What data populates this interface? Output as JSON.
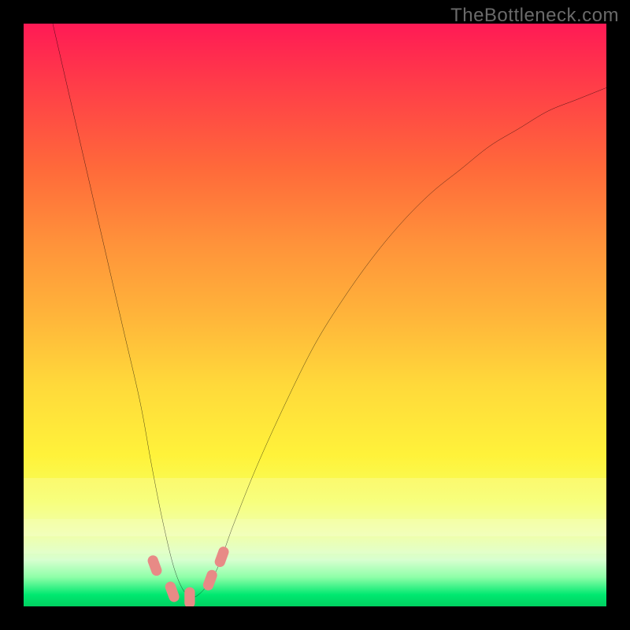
{
  "watermark": {
    "text": "TheBottleneck.com"
  },
  "colors": {
    "frame": "#000000",
    "curve": "#000000",
    "marker": "#e88a86",
    "grad_top": "#ff1a55",
    "grad_bottom": "#00d060"
  },
  "chart_data": {
    "type": "line",
    "title": "",
    "xlabel": "",
    "ylabel": "",
    "xlim": [
      0,
      100
    ],
    "ylim": [
      0,
      100
    ],
    "grid": false,
    "legend": false,
    "series": [
      {
        "name": "bottleneck-curve",
        "x": [
          5,
          8,
          11,
          14,
          17,
          20,
          22,
          24,
          26,
          28,
          30,
          33,
          36,
          40,
          45,
          50,
          55,
          60,
          65,
          70,
          75,
          80,
          85,
          90,
          95,
          100
        ],
        "y": [
          100,
          87,
          74,
          61,
          48,
          35,
          24,
          14,
          6,
          2,
          2,
          6,
          14,
          24,
          35,
          45,
          53,
          60,
          66,
          71,
          75,
          79,
          82,
          85,
          87,
          89
        ]
      }
    ],
    "optimum_band": {
      "x_start": 24,
      "x_end": 33,
      "y_max": 8
    },
    "markers": [
      {
        "x": 22.5,
        "y": 7
      },
      {
        "x": 25.5,
        "y": 2.5
      },
      {
        "x": 28.5,
        "y": 1.5
      },
      {
        "x": 32.0,
        "y": 4.5
      },
      {
        "x": 34.0,
        "y": 8.5
      }
    ]
  }
}
